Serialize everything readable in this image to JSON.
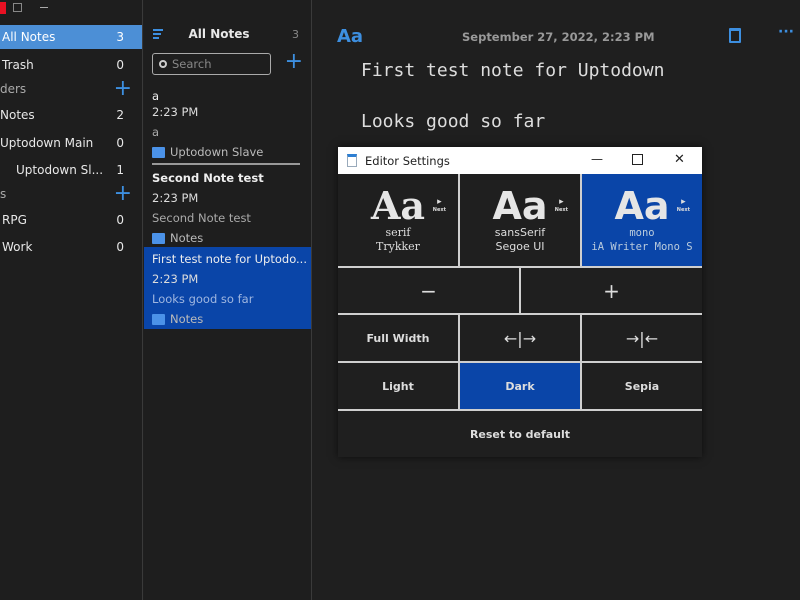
{
  "window_controls": {
    "close": "",
    "maximize": "☐",
    "minimize": "—"
  },
  "sidebar": {
    "items": [
      {
        "label": "All Notes",
        "count": "3"
      },
      {
        "label": "Trash",
        "count": "0"
      },
      {
        "label": "ders"
      },
      {
        "label": "Notes",
        "count": "2"
      },
      {
        "label": "Uptodown Main",
        "count": "0"
      },
      {
        "label": "Uptodown Sl...",
        "count": "1"
      },
      {
        "label": "s"
      },
      {
        "label": "RPG",
        "count": "0"
      },
      {
        "label": "Work",
        "count": "0"
      }
    ],
    "add": "+"
  },
  "list": {
    "title": "All Notes",
    "count": "3",
    "search_placeholder": "Search",
    "add": "+",
    "notes": [
      {
        "title": "a",
        "time": "2:23 PM",
        "preview": "a",
        "folder": "Uptodown Slave"
      },
      {
        "title": "Second Note test",
        "time": "2:23 PM",
        "preview": "Second Note test",
        "folder": "Notes"
      },
      {
        "title": "First test note for Uptodo...",
        "time": "2:23 PM",
        "preview": "Looks good so far",
        "folder": "Notes"
      }
    ]
  },
  "editor": {
    "font_button": "Aa",
    "date": "September 27, 2022, 2:23 PM",
    "more": "···",
    "lines": [
      "First test note for Uptodown",
      "Looks good so far"
    ]
  },
  "dialog": {
    "title": "Editor Settings",
    "min": "—",
    "max": "☐",
    "close": "✕",
    "fonts": [
      {
        "sample": "Aa",
        "next": "Next",
        "name": "serif",
        "font": "Trykker"
      },
      {
        "sample": "Aa",
        "next": "Next",
        "name": "sansSerif",
        "font": "Segoe UI"
      },
      {
        "sample": "Aa",
        "next": "Next",
        "name": "mono",
        "font": "iA Writer Mono S"
      }
    ],
    "decrease": "−",
    "increase": "+",
    "full_width": "Full Width",
    "widen": "←|→",
    "narrow": "→|←",
    "themes": [
      "Light",
      "Dark",
      "Sepia"
    ],
    "selected_theme": "Dark",
    "selected_font": "mono",
    "reset": "Reset to default"
  },
  "colors": {
    "accent": "#0a45a8",
    "sidebar_selected": "#4c8fd6",
    "icon_blue": "#3d8fe0"
  }
}
